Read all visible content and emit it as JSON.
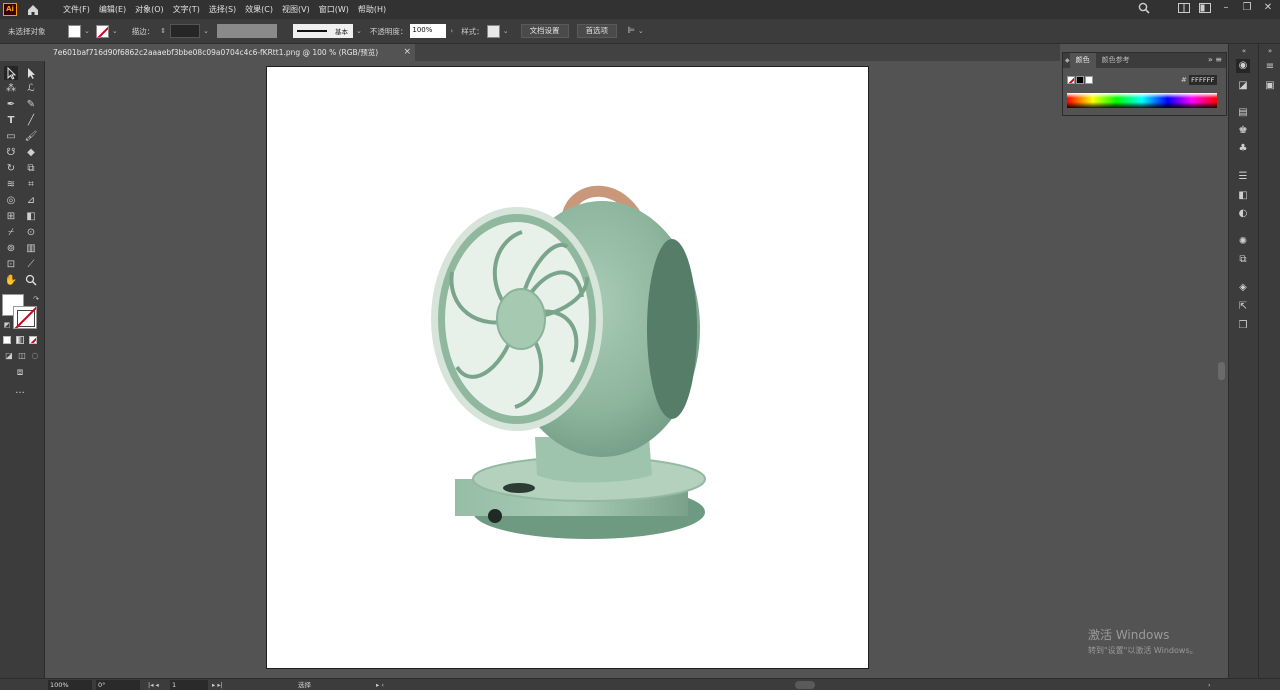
{
  "app": {
    "logo": "Ai"
  },
  "menu": [
    "文件(F)",
    "编辑(E)",
    "对象(O)",
    "文字(T)",
    "选择(S)",
    "效果(C)",
    "视图(V)",
    "窗口(W)",
    "帮助(H)"
  ],
  "control_bar": {
    "selection_status": "未选择对象",
    "stroke_label": "描边：",
    "stroke_profile": "基本",
    "opacity_label": "不透明度：",
    "opacity_value": "100%",
    "style_label": "样式：",
    "doc_setup_button": "文档设置",
    "preferences_button": "首选项"
  },
  "document": {
    "tab_title": "7e601baf716d90f6862c2aaaebf3bbe08c09a0704c4c6-fKRtt1.png @ 100 % (RGB/预览)"
  },
  "color_panel": {
    "tabs": [
      "颜色",
      "颜色参考"
    ],
    "hex_prefix": "#",
    "hex_value": "FFFFFF"
  },
  "status_bar": {
    "zoom": "100%",
    "rotation": "0°",
    "artboard": "1",
    "tool": "选择"
  },
  "watermark": {
    "line1": "激活 Windows",
    "line2": "转到\"设置\"以激活 Windows。"
  },
  "colors": {
    "fan_body": "#8fb8a0",
    "fan_dark": "#6f9a82",
    "handle": "#c9987a",
    "accent_red": "#d0021b"
  }
}
